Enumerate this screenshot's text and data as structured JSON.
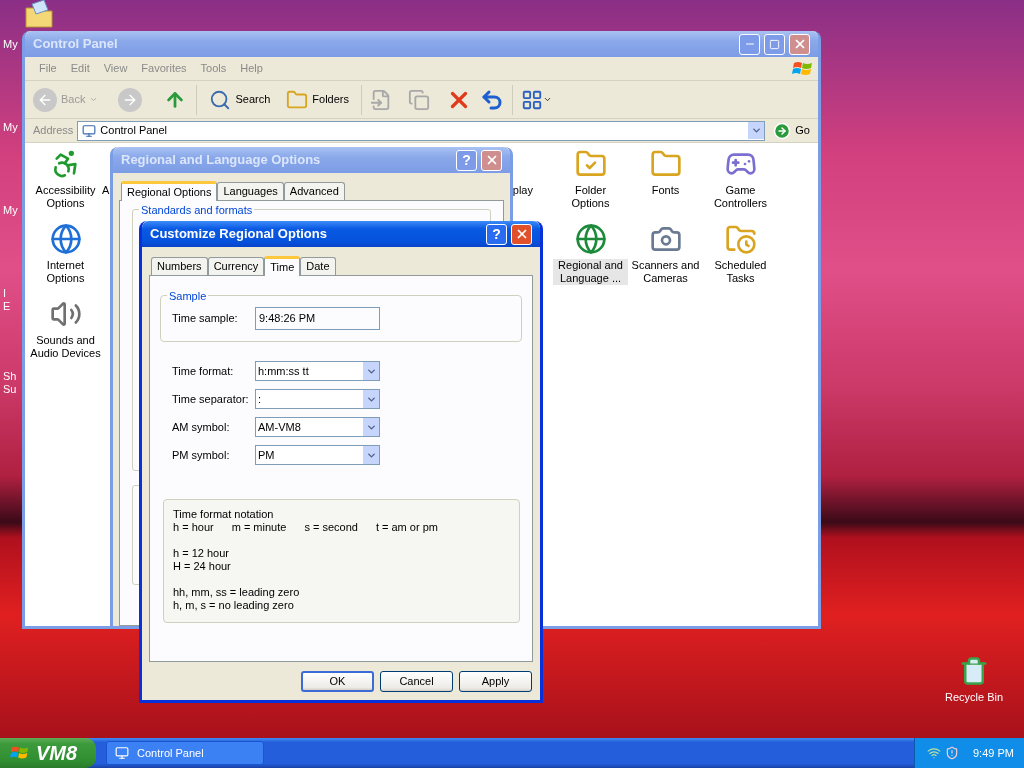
{
  "desktop": {
    "left_icons": [
      {
        "lines": [
          "My"
        ]
      },
      {
        "lines": [
          "My"
        ]
      },
      {
        "lines": [
          "My"
        ]
      },
      {
        "lines": [
          "I",
          "E"
        ]
      },
      {
        "lines": [
          "Sh",
          "Su"
        ]
      }
    ],
    "recycle_bin": "Recycle Bin"
  },
  "control_panel": {
    "title": "Control Panel",
    "active": false,
    "menu": [
      "File",
      "Edit",
      "View",
      "Favorites",
      "Tools",
      "Help"
    ],
    "toolbar": {
      "back": {
        "label": "Back",
        "disabled": true
      },
      "forward": {
        "disabled": true
      },
      "search": "Search",
      "folders": "Folders"
    },
    "address": {
      "label": "Address",
      "value": "Control Panel",
      "go": "Go"
    },
    "items": [
      {
        "label": "Accessibility Options",
        "kind": "full",
        "selected": false
      },
      {
        "label": "A",
        "kind": "cut",
        "selected": false
      },
      {
        "label": "play",
        "kind": "cut",
        "selected": false
      },
      {
        "label": "Folder Options",
        "kind": "full",
        "selected": false
      },
      {
        "label": "Fonts",
        "kind": "full",
        "selected": false
      },
      {
        "label": "Game Controllers",
        "kind": "full",
        "selected": false
      },
      {
        "label": "Internet Options",
        "kind": "full",
        "selected": false
      },
      {
        "label": "Regional and Language ...",
        "kind": "full",
        "selected": true
      },
      {
        "label": "Scanners and Cameras",
        "kind": "full",
        "selected": false
      },
      {
        "label": "Scheduled Tasks",
        "kind": "full",
        "selected": false
      },
      {
        "label": "Sounds and Audio Devices",
        "kind": "full",
        "selected": false
      }
    ]
  },
  "regional_dialog": {
    "title": "Regional and Language Options",
    "active": false,
    "help": "?",
    "tabs": [
      {
        "label": "Regional Options",
        "selected": true
      },
      {
        "label": "Languages",
        "selected": false
      },
      {
        "label": "Advanced",
        "selected": false
      }
    ],
    "group": "Standards and formats"
  },
  "customize_dialog": {
    "title": "Customize Regional Options",
    "active": true,
    "help": "?",
    "tabs": [
      {
        "label": "Numbers",
        "selected": false
      },
      {
        "label": "Currency",
        "selected": false
      },
      {
        "label": "Time",
        "selected": true
      },
      {
        "label": "Date",
        "selected": false
      }
    ],
    "sample": {
      "legend": "Sample",
      "label": "Time sample:",
      "value": "9:48:26 PM"
    },
    "fields": [
      {
        "label": "Time format:",
        "value": "h:mm:ss tt"
      },
      {
        "label": "Time separator:",
        "value": ":"
      },
      {
        "label": "AM symbol:",
        "value": "AM-VM8"
      },
      {
        "label": "PM symbol:",
        "value": "PM"
      }
    ],
    "notation": {
      "title": "Time format notation",
      "groups": [
        [
          [
            "h = hour",
            "m = minute",
            "s = second",
            "t = am or pm"
          ]
        ],
        [
          [
            "h = 12 hour"
          ],
          [
            "H = 24 hour"
          ]
        ],
        [
          [
            "hh, mm, ss = leading zero"
          ],
          [
            "h, m, s = no leading zero"
          ]
        ]
      ]
    },
    "buttons": [
      {
        "label": "OK",
        "default": true
      },
      {
        "label": "Cancel",
        "default": false
      },
      {
        "label": "Apply",
        "default": false
      }
    ]
  },
  "taskbar": {
    "start": "VM8",
    "tasks": [
      {
        "label": "Control Panel",
        "selected": false
      }
    ],
    "clock": "9:49 PM"
  }
}
